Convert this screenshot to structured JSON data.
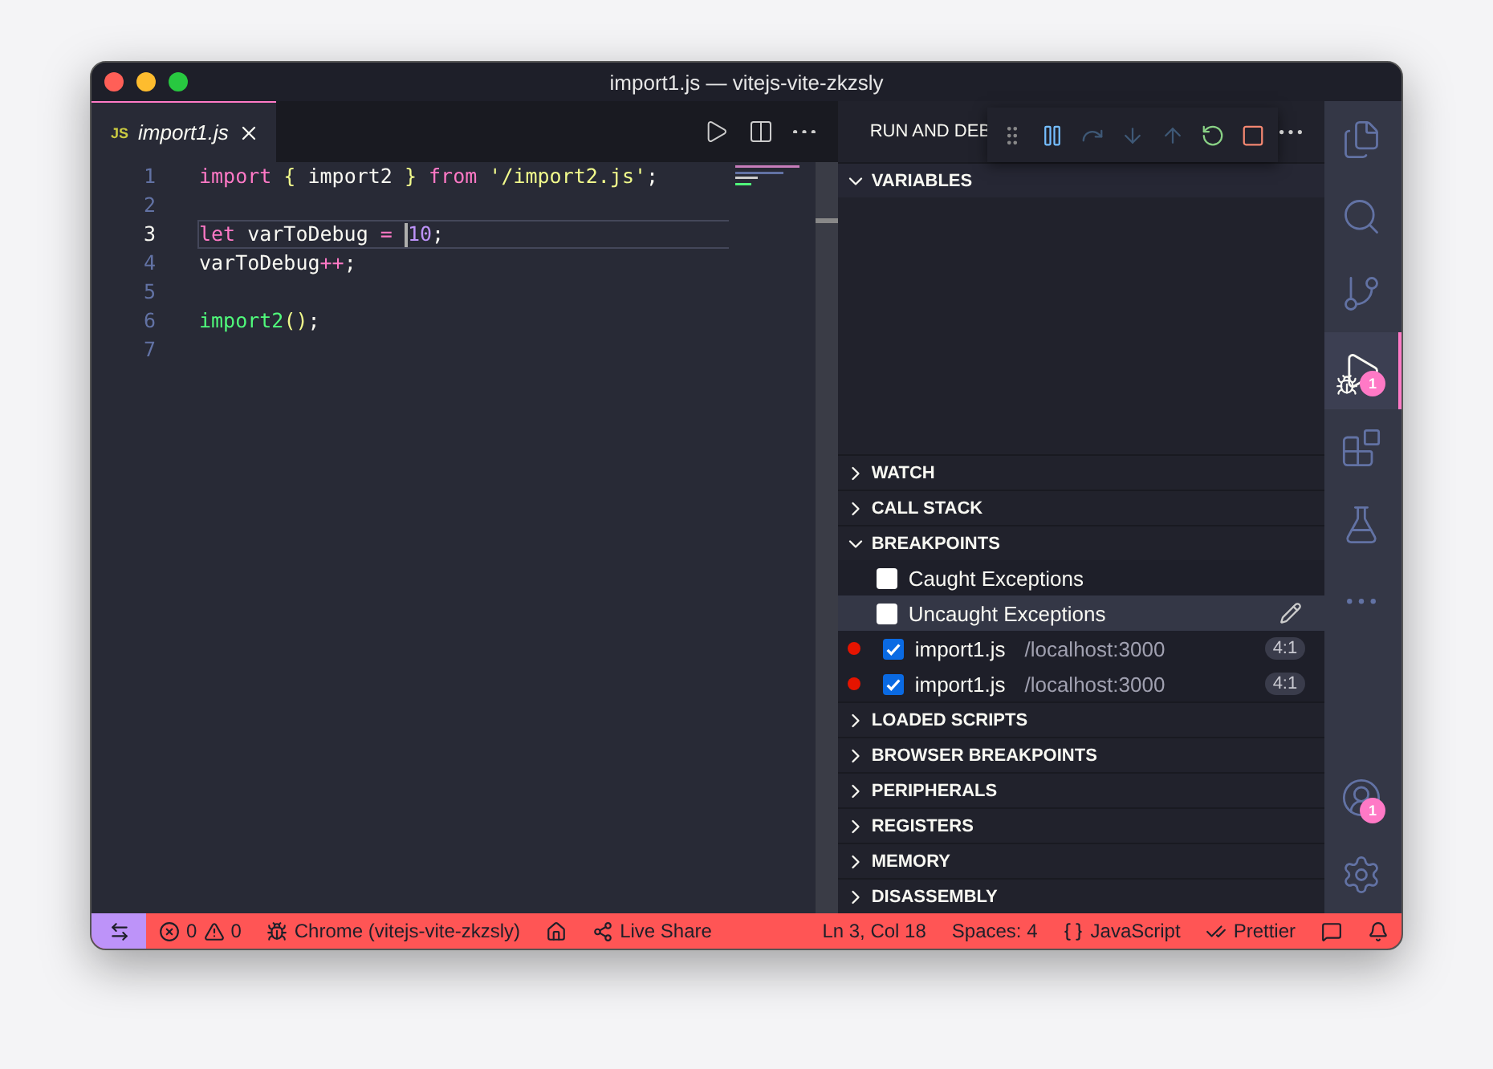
{
  "window": {
    "title": "import1.js — vitejs-vite-zkzsly"
  },
  "editor": {
    "tabs": [
      {
        "label": "import1.js",
        "icon": "JS",
        "selected": true
      }
    ],
    "lines": [
      {
        "number": "1",
        "current": false,
        "tokens": [
          {
            "kind": "keyword",
            "text": "import"
          },
          {
            "kind": "brace",
            "text": " {"
          },
          {
            "kind": "plain",
            "text": " import2"
          },
          {
            "kind": "brace",
            "text": " }"
          },
          {
            "kind": "keyword",
            "text": " from"
          },
          {
            "kind": "string",
            "text": " '/import2.js'"
          },
          {
            "kind": "plain",
            "text": ";"
          }
        ]
      },
      {
        "number": "2",
        "current": false
      },
      {
        "number": "3",
        "current": true,
        "tokens": [
          {
            "kind": "keyword",
            "text": "let"
          },
          {
            "kind": "plain",
            "text": " varToDebug "
          },
          {
            "kind": "keyword",
            "text": "= "
          },
          {
            "kind": "number",
            "text": "10",
            "cursor": true
          },
          {
            "kind": "plain",
            "text": ";"
          }
        ]
      },
      {
        "number": "4",
        "current": false,
        "tokens": [
          {
            "kind": "plain",
            "text": "varToDebug"
          },
          {
            "kind": "keyword",
            "text": "++"
          },
          {
            "kind": "plain",
            "text": ";"
          }
        ]
      },
      {
        "number": "5",
        "current": false
      },
      {
        "number": "6",
        "current": false,
        "tokens": [
          {
            "kind": "function",
            "text": "import2"
          },
          {
            "kind": "brace",
            "text": "()"
          },
          {
            "kind": "plain",
            "text": ";"
          }
        ]
      },
      {
        "number": "7",
        "current": false
      }
    ]
  },
  "sidebar": {
    "title": "RUN AND DEB",
    "debug_toolbar": [
      {
        "kind": "grip",
        "disabled": false
      },
      {
        "kind": "pause",
        "disabled": false
      },
      {
        "kind": "step-over",
        "disabled": true
      },
      {
        "kind": "step-into",
        "disabled": true
      },
      {
        "kind": "step-out",
        "disabled": true
      },
      {
        "kind": "restart",
        "disabled": false
      },
      {
        "kind": "stop",
        "disabled": false
      }
    ],
    "sections": [
      {
        "title": "VARIABLES",
        "expanded": true
      },
      {
        "title": "WATCH",
        "expanded": false
      },
      {
        "title": "CALL STACK",
        "expanded": false
      },
      {
        "title": "BREAKPOINTS",
        "expanded": true,
        "items": [
          {
            "kind": "exception",
            "label": "Caught Exceptions",
            "checked": false,
            "selected": false
          },
          {
            "kind": "exception",
            "label": "Uncaught Exceptions",
            "checked": false,
            "selected": true
          },
          {
            "kind": "breakpoint",
            "label": "import1.js",
            "path": "/localhost:3000",
            "position": "4:1",
            "checked": true,
            "selected": false
          },
          {
            "kind": "breakpoint",
            "label": "import1.js",
            "path": "/localhost:3000",
            "position": "4:1",
            "checked": true,
            "selected": false
          }
        ]
      },
      {
        "title": "LOADED SCRIPTS",
        "expanded": false
      },
      {
        "title": "BROWSER BREAKPOINTS",
        "expanded": false
      },
      {
        "title": "PERIPHERALS",
        "expanded": false
      },
      {
        "title": "REGISTERS",
        "expanded": false
      },
      {
        "title": "MEMORY",
        "expanded": false
      },
      {
        "title": "DISASSEMBLY",
        "expanded": false
      }
    ]
  },
  "activity_bar": {
    "top": [
      {
        "kind": "files",
        "selected": false
      },
      {
        "kind": "search",
        "selected": false
      },
      {
        "kind": "source-control",
        "selected": false
      },
      {
        "kind": "run-debug",
        "selected": true,
        "badge": "1"
      },
      {
        "kind": "extensions",
        "selected": false
      },
      {
        "kind": "testing",
        "selected": false
      },
      {
        "kind": "more",
        "selected": false
      }
    ],
    "bottom": [
      {
        "kind": "accounts",
        "selected": false,
        "badge": "1"
      },
      {
        "kind": "settings",
        "selected": false
      }
    ]
  },
  "status_bar": {
    "left": [
      {
        "kind": "remote"
      },
      {
        "kind": "problems",
        "errors": "0",
        "warnings": "0"
      },
      {
        "kind": "debug",
        "text": "Chrome (vitejs-vite-zkzsly)"
      },
      {
        "kind": "home"
      },
      {
        "kind": "live-share",
        "text": "Live Share"
      }
    ],
    "right": [
      {
        "kind": "text",
        "text": "Ln 3, Col 18"
      },
      {
        "kind": "text",
        "text": "Spaces: 4"
      },
      {
        "kind": "language",
        "text": "JavaScript"
      },
      {
        "kind": "prettier",
        "text": "Prettier"
      },
      {
        "kind": "feedback"
      },
      {
        "kind": "bell"
      }
    ]
  }
}
